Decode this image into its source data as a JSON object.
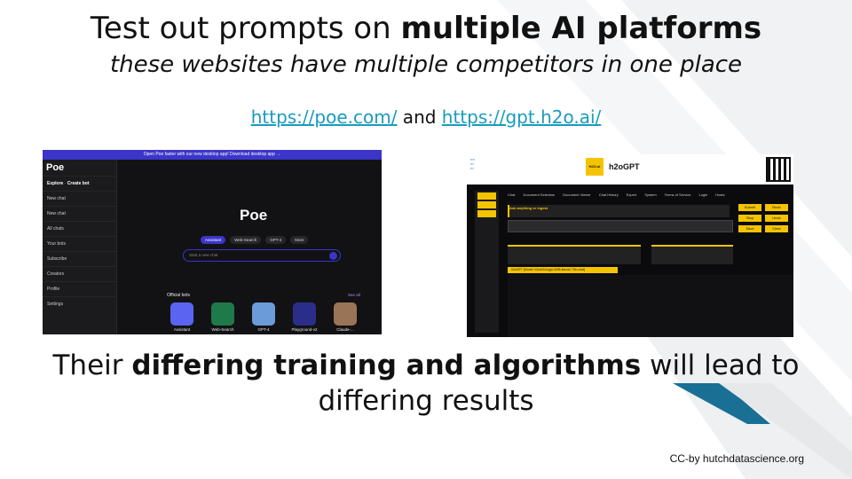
{
  "slide": {
    "title_plain": "Test out prompts on ",
    "title_bold": "multiple AI platforms",
    "subtitle": "these websites have multiple competitors in one place",
    "link1": "https://poe.com/",
    "link_sep": "  and ",
    "link2": "https://gpt.h2o.ai/",
    "bottom_plain1": "Their ",
    "bottom_bold": "differing training and algorithms",
    "bottom_plain2": " will lead to differing results",
    "credit": "CC-by hutchdatascience.org"
  },
  "poe": {
    "banner": "Open Poe faster with our new desktop app! Download desktop app →",
    "logo": "Poe",
    "sidebar": [
      "Explore",
      "Create bot",
      "New chat",
      "New chat",
      "All chats",
      "Your bots",
      "Subscribe",
      "Creators",
      "Profile",
      "Settings"
    ],
    "main_logo": "Poe",
    "chips": [
      "Assistant",
      "Web-Search",
      "GPT-4",
      "More"
    ],
    "input_placeholder": "Start a new chat",
    "official_bots": "Official bots",
    "see_all": "See all",
    "bots": [
      {
        "name": "Assistant",
        "color": "#5a64f0"
      },
      {
        "name": "Web-Search",
        "color": "#1f7a4a"
      },
      {
        "name": "GPT-4",
        "color": "#6b9bd8"
      },
      {
        "name": "Playground-v2",
        "color": "#2a2e8a"
      },
      {
        "name": "Claude-...",
        "color": "#9a7456"
      }
    ]
  },
  "h2o": {
    "brand_badge": "H2O.ai",
    "name": "h2oGPT",
    "tabs": [
      "Chat",
      "Document Selection",
      "Document Viewer",
      "Chat History",
      "Expert",
      "System",
      "Terms of Service",
      "Login",
      "Hosts"
    ],
    "ask": "Ask anything or ingest",
    "buttons": [
      "Submit",
      "Redo",
      "Stop",
      "Undo",
      "Save",
      "Clear"
    ],
    "model_tag": "h2oGPT [Model: h2oai/h2ogpt-4096-llama2-70b-chat]"
  }
}
